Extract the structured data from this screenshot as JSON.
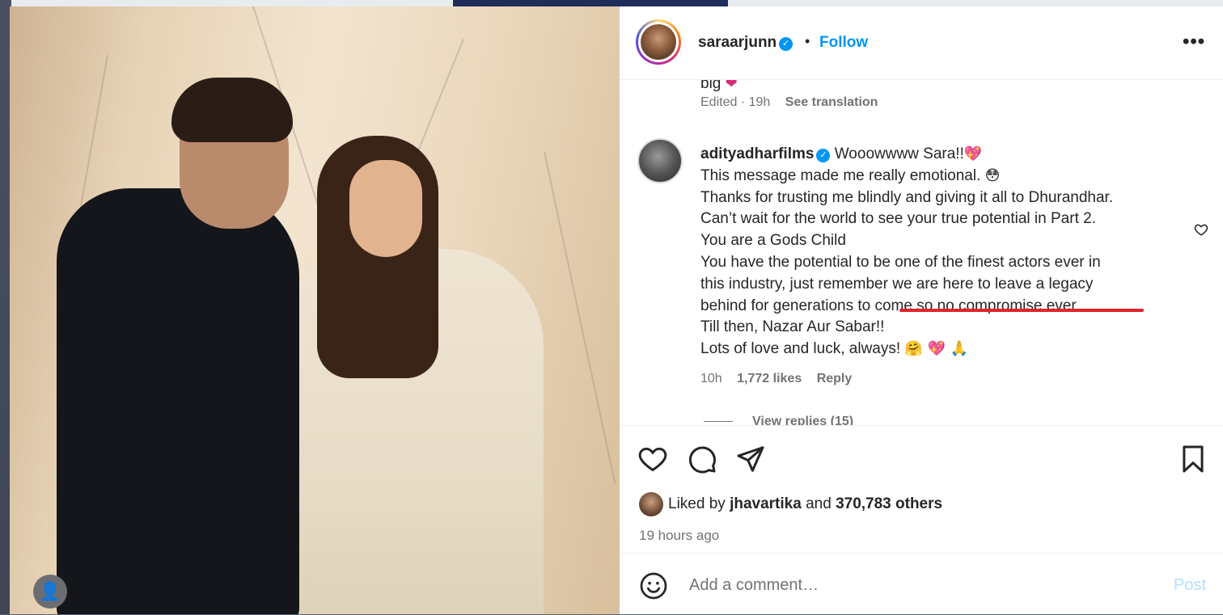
{
  "post": {
    "author": "saraarjunn",
    "follow_label": "Follow",
    "separator": "•",
    "more_label": "•••"
  },
  "caption_tail": {
    "cut_text": "big",
    "edited": "Edited · 19h",
    "see_translation": "See translation"
  },
  "comment": {
    "username": "adityadharfilms",
    "lines": [
      "Wooowwww Sara!!",
      "This message made me really emotional.",
      "Thanks for trusting me blindly and giving it all to Dhurandhar.",
      "Can’t wait for the world to see your true potential in Part 2.",
      "You are a Gods Child",
      "You have the potential to be one of the finest actors ever in",
      "this industry, just remember we are here to leave a legacy",
      "behind for generations to come so no compromise ever.",
      "Till then, Nazar Aur Sabar!!",
      "Lots of love and luck, always!"
    ],
    "emoji_line1": "💖",
    "emoji_line2": "😳",
    "emoji_last": "🤗 💖 🙏",
    "time": "10h",
    "likes": "1,772 likes",
    "reply": "Reply",
    "view_replies": "View replies (15)"
  },
  "likes": {
    "liked_by_prefix": "Liked by",
    "liked_by_user": "jhavartika",
    "and": "and",
    "others": "370,783 others",
    "time_ago": "19 hours ago"
  },
  "comment_box": {
    "placeholder": "Add a comment…",
    "post_label": "Post"
  },
  "colors": {
    "accent": "#0095f6",
    "underline": "#e0242c",
    "muted": "#737373"
  },
  "icons": [
    "heart-icon",
    "comment-icon",
    "share-icon",
    "bookmark-icon",
    "emoji-icon",
    "more-icon",
    "verified-icon",
    "user-icon"
  ]
}
